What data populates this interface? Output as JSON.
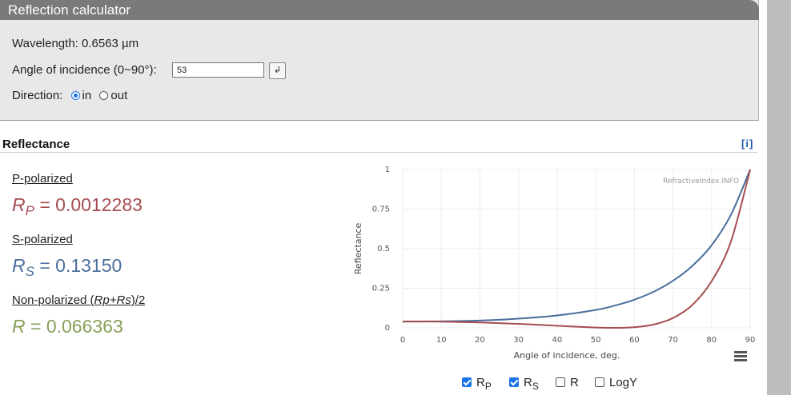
{
  "window": {
    "title": "Reflection calculator"
  },
  "inputs": {
    "wavelength_label": "Wavelength: 0.6563 µm",
    "angle_label": "Angle of incidence (0~90°):",
    "angle_value": "53",
    "enter_symbol": "↲",
    "direction_label": "Direction:",
    "direction_in": "in",
    "direction_out": "out",
    "direction_selected": "in"
  },
  "section": {
    "title": "Reflectance",
    "info": "[i]"
  },
  "results": {
    "p_label": "P-polarized",
    "p_symbol": "R",
    "p_sub": "P",
    "p_value": "= 0.0012283",
    "s_label": "S-polarized",
    "s_symbol": "R",
    "s_sub": "S",
    "s_value": "= 0.13150",
    "n_label_prefix": "Non-polarized (",
    "n_label_formula": "Rp+Rs",
    "n_label_suffix": ")/2",
    "n_symbol": "R",
    "n_value": "= 0.066363"
  },
  "legend": {
    "rp_main": "R",
    "rp_sub": "P",
    "rp_checked": true,
    "rs_main": "R",
    "rs_sub": "S",
    "rs_checked": true,
    "r_label": "R",
    "r_checked": false,
    "logy_label": "LogY",
    "logy_checked": false
  },
  "icons": {
    "menu": "hamburger-menu-icon"
  },
  "colors": {
    "rp": "#a64d51",
    "rs": "#4a6e9c",
    "r": "#87a05a",
    "titlebar": "#7a7a7a"
  },
  "chart_data": {
    "type": "line",
    "watermark": "RefractiveIndex.INFO",
    "xlabel": "Angle of incidence, deg.",
    "ylabel": "Reflectance",
    "xlim": [
      0,
      90
    ],
    "ylim": [
      0,
      1
    ],
    "xticks": [
      0,
      10,
      20,
      30,
      40,
      50,
      60,
      70,
      80,
      90
    ],
    "yticks": [
      0,
      0.25,
      0.5,
      0.75,
      1
    ],
    "ytick_labels": [
      "0",
      "0.25",
      "0.5",
      "0.75",
      "1"
    ],
    "grid": true,
    "x": [
      0,
      10,
      20,
      30,
      40,
      50,
      55,
      60,
      65,
      70,
      75,
      80,
      85,
      90
    ],
    "series": [
      {
        "key": "rs",
        "color": "#4a6e9c",
        "values": [
          0.04,
          0.041,
          0.046,
          0.058,
          0.078,
          0.113,
          0.141,
          0.178,
          0.228,
          0.297,
          0.391,
          0.521,
          0.713,
          1.0
        ]
      },
      {
        "key": "rp",
        "color": "#a64d51",
        "values": [
          0.04,
          0.039,
          0.034,
          0.025,
          0.013,
          0.002,
          0.0,
          0.004,
          0.021,
          0.062,
          0.144,
          0.294,
          0.544,
          1.0
        ]
      }
    ]
  }
}
